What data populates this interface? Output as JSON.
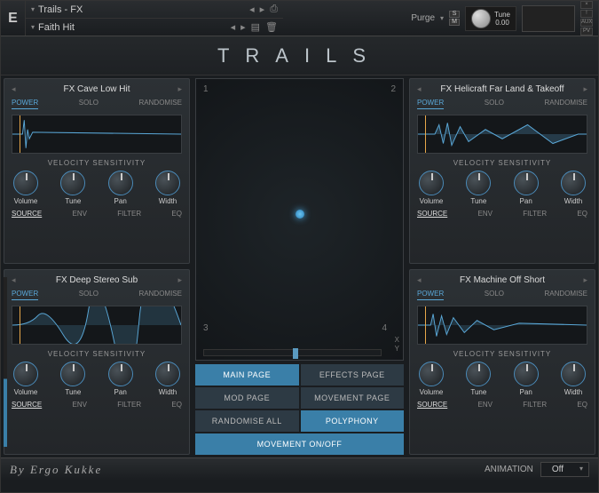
{
  "header": {
    "logo": "E",
    "instrument": "Trails - FX",
    "preset": "Faith Hit",
    "purge": "Purge",
    "tune_label": "Tune",
    "tune_value": "0.00"
  },
  "title": "TRAILS",
  "panels": [
    {
      "title": "FX Cave Low Hit",
      "tabs": {
        "power": "POWER",
        "solo": "SOLO",
        "randomise": "RANDOMISE"
      },
      "velsens": "VELOCITY SENSITIVITY",
      "knobs": {
        "volume": "Volume",
        "tune": "Tune",
        "pan": "Pan",
        "width": "Width"
      },
      "bottom_tabs": {
        "source": "SOURCE",
        "env": "ENV",
        "filter": "FILTER",
        "eq": "EQ"
      },
      "wave_type": "hit"
    },
    {
      "title": "FX Helicraft Far Land & Takeoff",
      "tabs": {
        "power": "POWER",
        "solo": "SOLO",
        "randomise": "RANDOMISE"
      },
      "velsens": "VELOCITY SENSITIVITY",
      "knobs": {
        "volume": "Volume",
        "tune": "Tune",
        "pan": "Pan",
        "width": "Width"
      },
      "bottom_tabs": {
        "source": "SOURCE",
        "env": "ENV",
        "filter": "FILTER",
        "eq": "EQ"
      },
      "wave_type": "dense"
    },
    {
      "title": "FX Deep Stereo Sub",
      "tabs": {
        "power": "POWER",
        "solo": "SOLO",
        "randomise": "RANDOMISE"
      },
      "velsens": "VELOCITY SENSITIVITY",
      "knobs": {
        "volume": "Volume",
        "tune": "Tune",
        "pan": "Pan",
        "width": "Width"
      },
      "bottom_tabs": {
        "source": "SOURCE",
        "env": "ENV",
        "filter": "FILTER",
        "eq": "EQ"
      },
      "wave_type": "swell"
    },
    {
      "title": "FX Machine Off Short",
      "tabs": {
        "power": "POWER",
        "solo": "SOLO",
        "randomise": "RANDOMISE"
      },
      "velsens": "VELOCITY SENSITIVITY",
      "knobs": {
        "volume": "Volume",
        "tune": "Tune",
        "pan": "Pan",
        "width": "Width"
      },
      "bottom_tabs": {
        "source": "SOURCE",
        "env": "ENV",
        "filter": "FILTER",
        "eq": "EQ"
      },
      "wave_type": "machine"
    }
  ],
  "xy": {
    "n1": "1",
    "n2": "2",
    "n3": "3",
    "n4": "4",
    "x": "X",
    "y": "Y"
  },
  "buttons": {
    "main": "MAIN PAGE",
    "effects": "EFFECTS PAGE",
    "mod": "MOD PAGE",
    "movement": "MOVEMENT PAGE",
    "randomise_all": "RANDOMISE ALL",
    "polyphony": "POLYPHONY",
    "movement_toggle": "MOVEMENT ON/OFF"
  },
  "footer": {
    "byline": "By Ergo Kukke",
    "anim_label": "ANIMATION",
    "anim_value": "Off"
  }
}
